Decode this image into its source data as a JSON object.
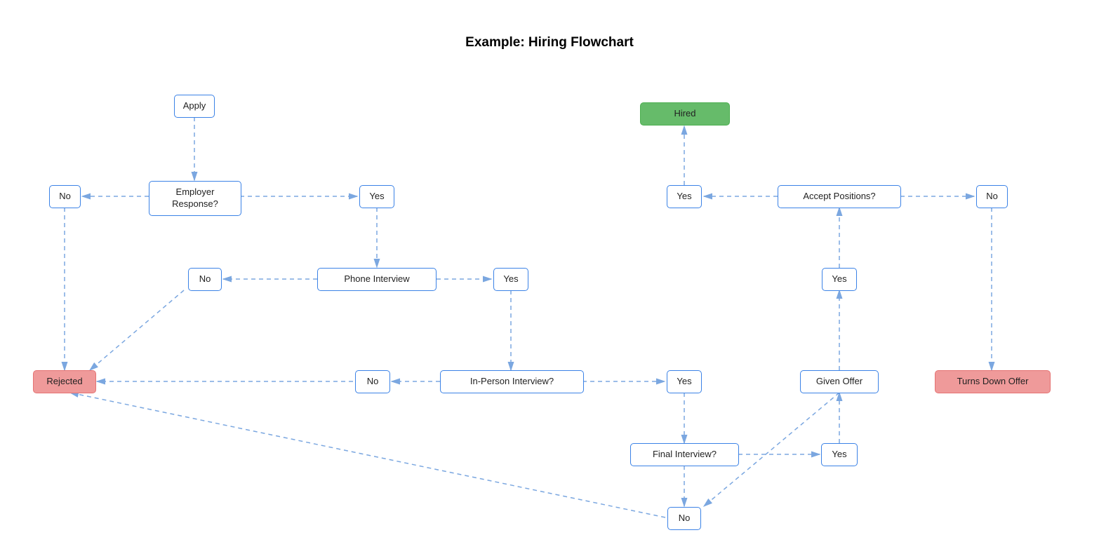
{
  "title": "Example: Hiring Flowchart",
  "nodes": {
    "apply": "Apply",
    "employer_response": "Employer\nResponse?",
    "er_no": "No",
    "er_yes": "Yes",
    "phone_interview": "Phone Interview",
    "pi_no": "No",
    "pi_yes": "Yes",
    "rejected": "Rejected",
    "in_person": "In-Person Interview?",
    "ip_no": "No",
    "ip_yes": "Yes",
    "final_interview": "Final Interview?",
    "fi_yes": "Yes",
    "fi_no": "No",
    "given_offer": "Given Offer",
    "go_yes": "Yes",
    "accept_positions": "Accept Positions?",
    "ap_yes": "Yes",
    "ap_no": "No",
    "hired": "Hired",
    "turns_down": "Turns Down Offer"
  }
}
